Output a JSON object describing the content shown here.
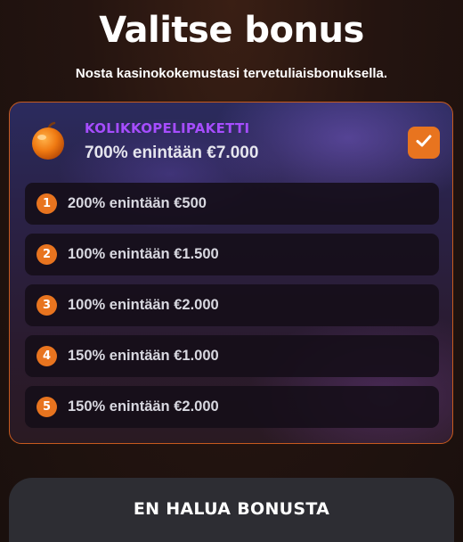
{
  "header": {
    "title": "Valitse bonus",
    "subtitle": "Nosta kasinokokemustasi tervetuliaisbonuksella."
  },
  "package": {
    "icon": "fruit-icon",
    "name": "KOLIKKOPELIPAKETTI",
    "offer": "700% enintään €7.000",
    "checked": true,
    "name_color": "#a64dff"
  },
  "bonuses": [
    {
      "number": "1",
      "text": "200% enintään €500"
    },
    {
      "number": "2",
      "text": "100% enintään €1.500"
    },
    {
      "number": "3",
      "text": "100% enintään €2.000"
    },
    {
      "number": "4",
      "text": "150% enintään €1.000"
    },
    {
      "number": "5",
      "text": "150% enintään €2.000"
    }
  ],
  "footer": {
    "no_bonus_label": "EN HALUA BONUSTA"
  },
  "colors": {
    "accent": "#e8741f",
    "panel_border": "#c75a1e",
    "item_background": "#140e18",
    "button_background": "#2d2d33"
  }
}
